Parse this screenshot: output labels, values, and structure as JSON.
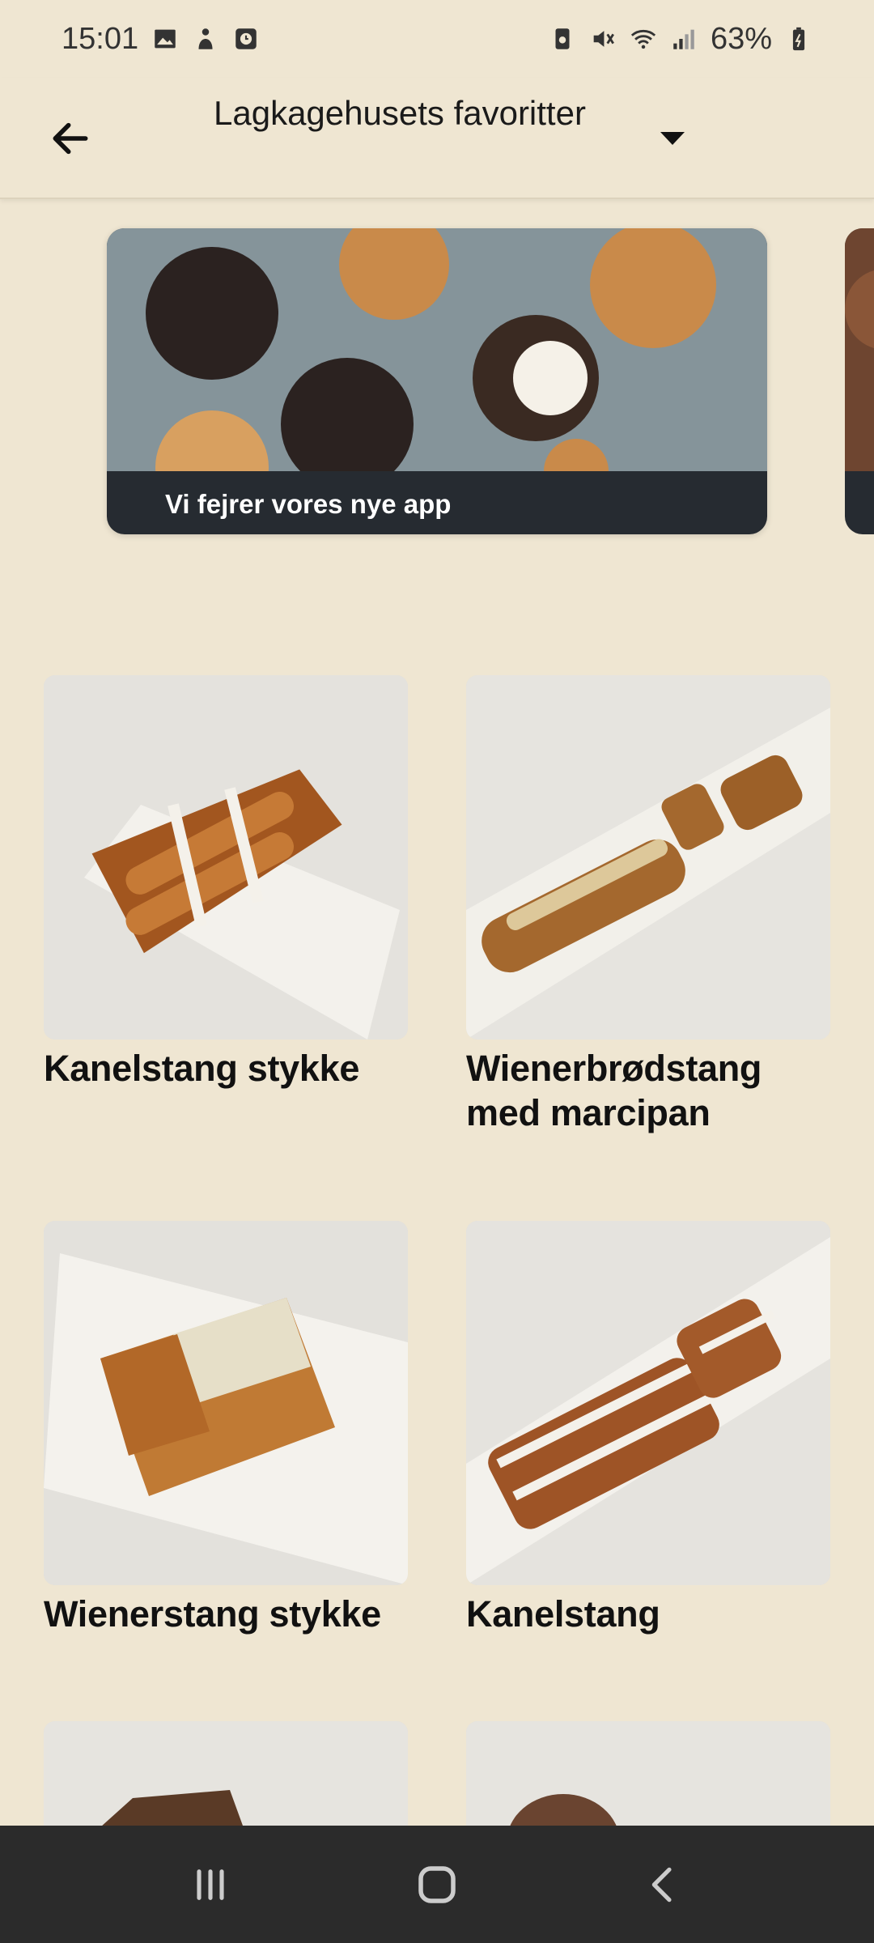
{
  "status_bar": {
    "time": "15:01",
    "battery": "63%",
    "icons_left": [
      "image-icon",
      "figure-icon",
      "clock-app-icon"
    ],
    "icons_right": [
      "battery-saver-icon",
      "mute-icon",
      "wifi-icon",
      "signal-icon",
      "battery-icon"
    ]
  },
  "app_bar": {
    "title": "Lagkagehusets favoritter",
    "back_icon": "arrow-left-icon",
    "dropdown_icon": "caret-down-icon"
  },
  "banner": {
    "caption": "Vi fejrer vores nye app",
    "image": "muffins-image"
  },
  "products": [
    {
      "name": "Kanelstang stykke",
      "image": "kanelstang-stykke-image"
    },
    {
      "name": "Wienerbrødstang med marcipan",
      "image": "wienerbrodstang-image"
    },
    {
      "name": "Wienerstang stykke",
      "image": "wienerstang-stykke-image"
    },
    {
      "name": "Kanelstang",
      "image": "kanelstang-image"
    }
  ],
  "nav_bar": {
    "items": [
      "recent-apps-icon",
      "home-icon",
      "back-icon"
    ]
  },
  "colors": {
    "background": "#efe6d2",
    "banner_dark": "#262b31",
    "nav_bar": "#2b2b2b"
  }
}
